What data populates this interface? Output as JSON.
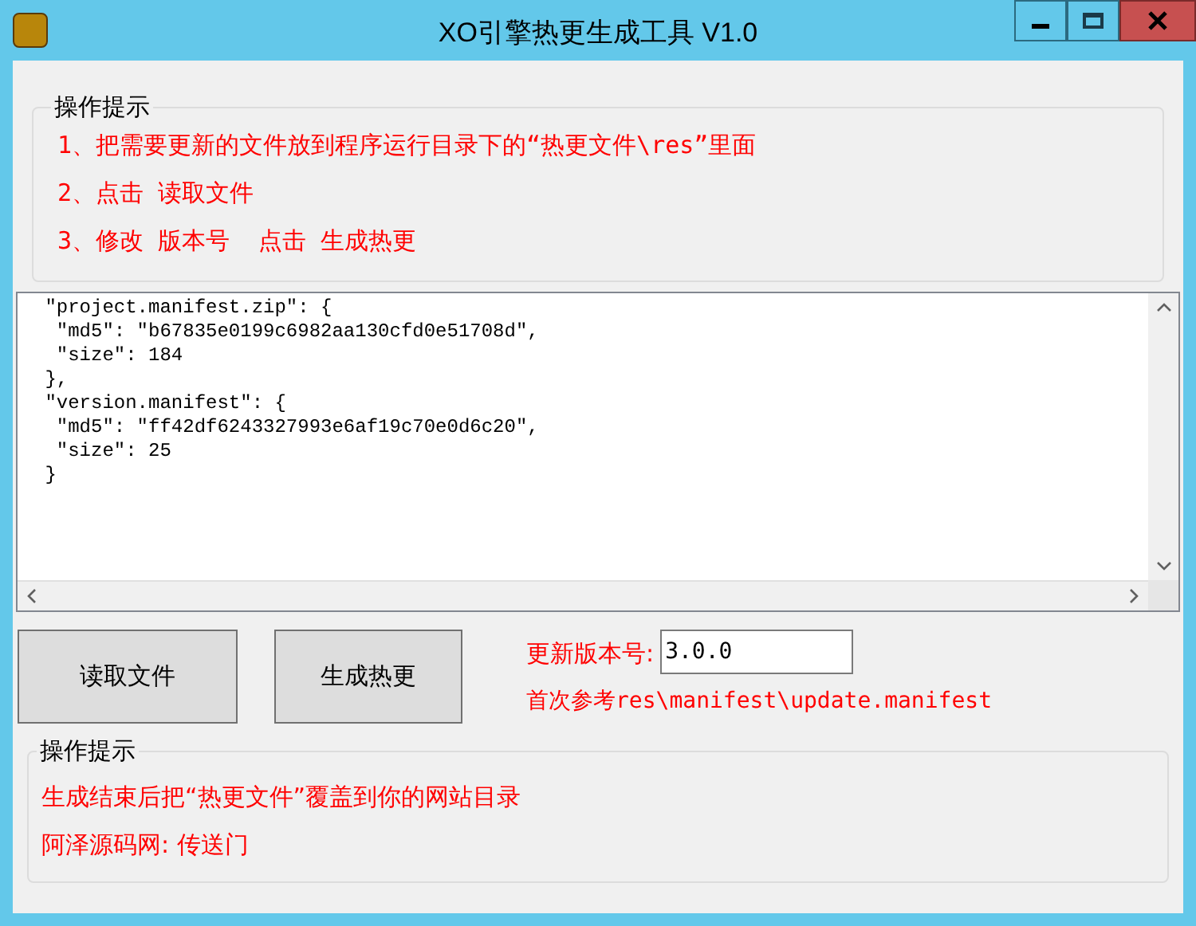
{
  "window": {
    "title": "XO引擎热更生成工具 V1.0"
  },
  "tips": {
    "title": "操作提示",
    "lines": [
      "1、把需要更新的文件放到程序运行目录下的“热更文件\\res”里面",
      "2、点击 读取文件",
      "3、修改 版本号  点击 生成热更"
    ]
  },
  "output": {
    "lines": [
      " \"project.manifest.zip\": {",
      "  \"md5\": \"b67835e0199c6982aa130cfd0e51708d\",",
      "  \"size\": 184",
      " },",
      " \"version.manifest\": {",
      "  \"md5\": \"ff42df6243327993e6af19c70e0d6c20\",",
      "  \"size\": 25",
      " }"
    ]
  },
  "buttons": [
    "读取文件",
    "生成热更"
  ],
  "version": {
    "label": "更新版本号:",
    "value": "3.0.0",
    "hint": "首次参考res\\manifest\\update.manifest"
  },
  "notes": {
    "title": "操作提示",
    "lines": [
      "生成结束后把“热更文件”覆盖到你的网站目录",
      "阿泽源码网: 传送门"
    ]
  }
}
